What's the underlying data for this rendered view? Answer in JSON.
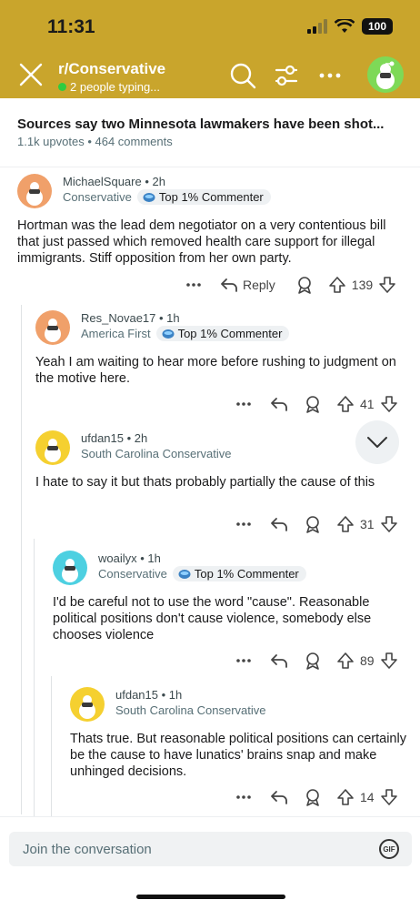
{
  "status": {
    "time": "11:31",
    "battery": "100"
  },
  "header": {
    "subreddit": "r/Conservative",
    "typing": "2 people typing..."
  },
  "post": {
    "title": "Sources say two Minnesota lawmakers have been shot...",
    "stats": "1.1k upvotes • 464 comments"
  },
  "comments": [
    {
      "username": "MichaelSquare",
      "age": "2h",
      "flair": "Conservative",
      "badge": "Top 1% Commenter",
      "body": "Hortman was the lead dem negotiator on a very contentious bill that just passed which removed health care support for illegal immigrants. Stiff opposition from her own party.",
      "reply_label": "Reply",
      "votes": "139",
      "avatar_color": "#f0a06a"
    },
    {
      "username": "Res_Novae17",
      "age": "1h",
      "flair": "America First",
      "badge": "Top 1% Commenter",
      "body": "Yeah I am waiting to hear more before rushing to judgment on the motive here.",
      "votes": "41",
      "avatar_color": "#f0a06a"
    },
    {
      "username": "ufdan15",
      "age": "2h",
      "flair": "South Carolina Conservative",
      "body": "I hate to say it but thats probably partially the cause of this",
      "votes": "31",
      "avatar_color": "#f5d030"
    },
    {
      "username": "woailyx",
      "age": "1h",
      "flair": "Conservative",
      "badge": "Top 1% Commenter",
      "body": "I'd be careful not to use the word \"cause\". Reasonable political positions don't cause violence, somebody else chooses violence",
      "votes": "89",
      "avatar_color": "#4dd0e1"
    },
    {
      "username": "ufdan15",
      "age": "1h",
      "flair": "South Carolina Conservative",
      "body": "Thats true. But reasonable political positions can certainly be the cause to have lunatics' brains snap and make unhinged decisions.",
      "votes": "14",
      "avatar_color": "#f5d030"
    }
  ],
  "composer": {
    "placeholder": "Join the conversation",
    "gif_label": "GIF"
  },
  "colors": {
    "header_bg": "#c9a52c",
    "accent_link": "#3c4a4e"
  }
}
